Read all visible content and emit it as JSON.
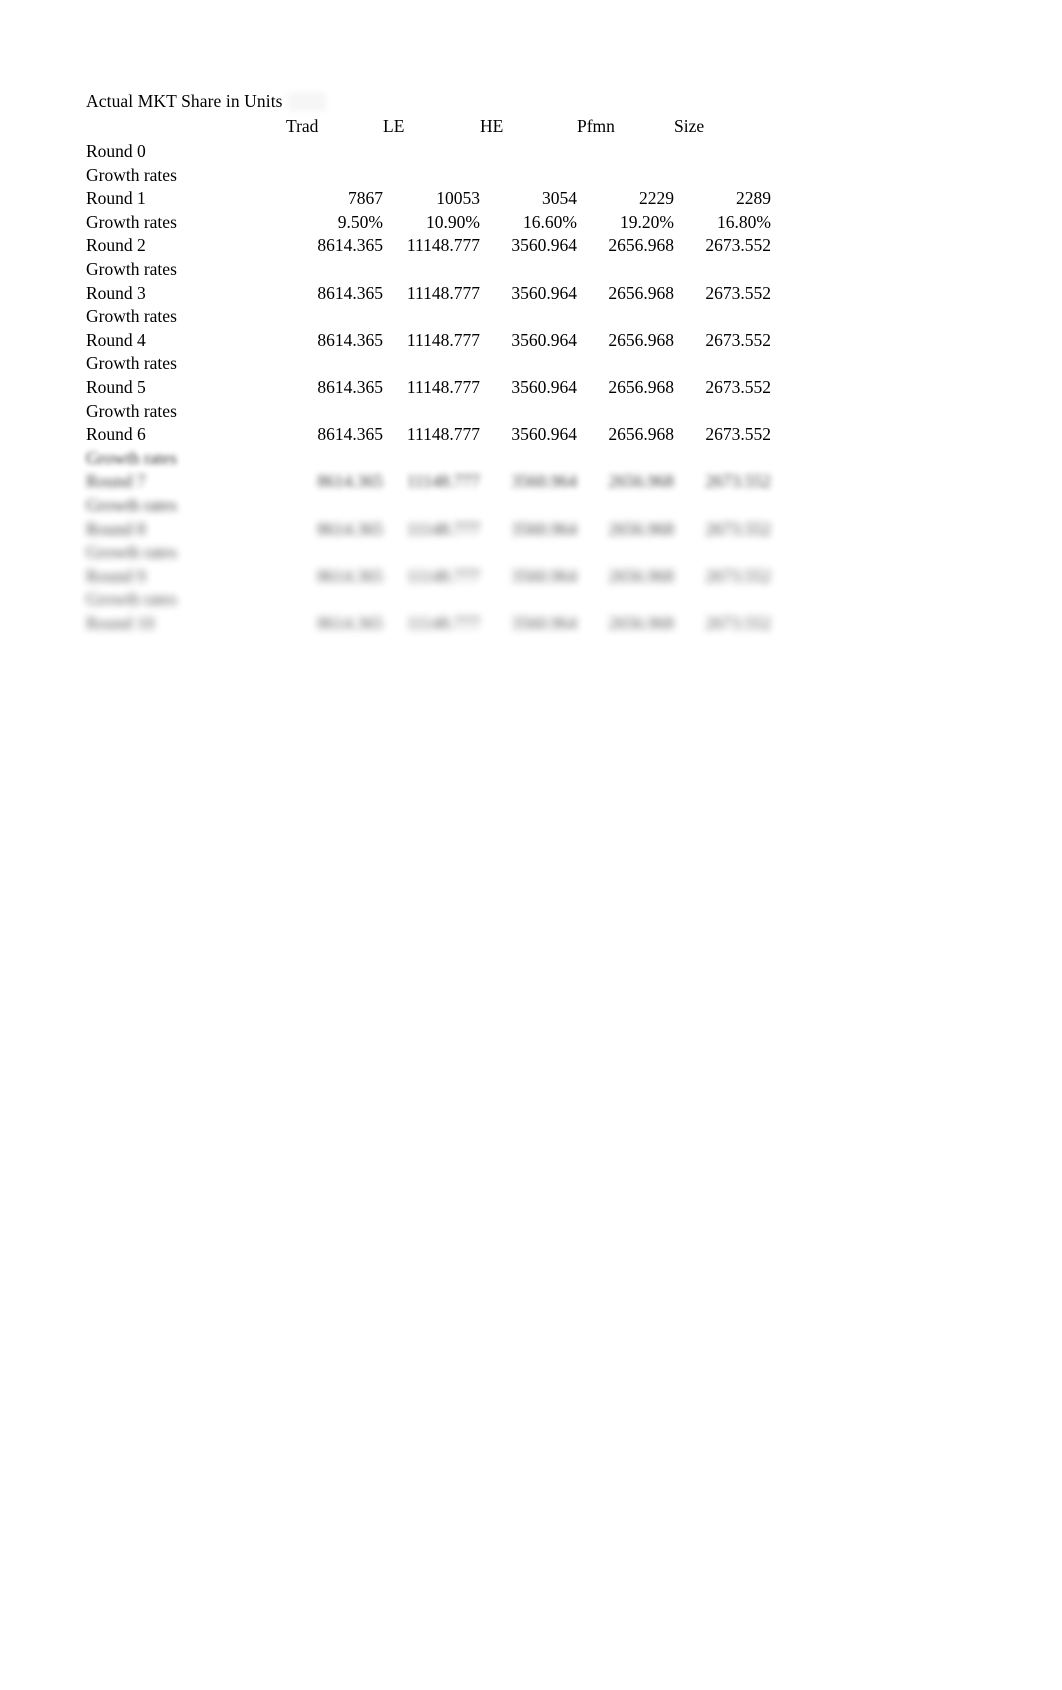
{
  "document": {
    "title": "Actual MKT Share in Units"
  },
  "table": {
    "row_header_label": "",
    "columns": [
      "Trad",
      "LE",
      "HE",
      "Pfmn",
      "Size"
    ],
    "rows": [
      {
        "label": "Round 0",
        "kind": "round",
        "values": [
          "",
          "",
          "",
          "",
          ""
        ]
      },
      {
        "label": "Growth rates",
        "kind": "growth",
        "values": [
          "",
          "",
          "",
          "",
          ""
        ]
      },
      {
        "label": "Round 1",
        "kind": "round",
        "values": [
          "7867",
          "10053",
          "3054",
          "2229",
          "2289"
        ]
      },
      {
        "label": "Growth rates",
        "kind": "growth",
        "values": [
          "9.50%",
          "10.90%",
          "16.60%",
          "19.20%",
          "16.80%"
        ]
      },
      {
        "label": "Round 2",
        "kind": "round",
        "values": [
          "8614.365",
          "11148.777",
          "3560.964",
          "2656.968",
          "2673.552"
        ]
      },
      {
        "label": "Growth rates",
        "kind": "growth",
        "values": [
          "",
          "",
          "",
          "",
          ""
        ]
      },
      {
        "label": "Round 3",
        "kind": "round",
        "values": [
          "8614.365",
          "11148.777",
          "3560.964",
          "2656.968",
          "2673.552"
        ]
      },
      {
        "label": "Growth rates",
        "kind": "growth",
        "values": [
          "",
          "",
          "",
          "",
          ""
        ]
      },
      {
        "label": "Round 4",
        "kind": "round",
        "values": [
          "8614.365",
          "11148.777",
          "3560.964",
          "2656.968",
          "2673.552"
        ]
      },
      {
        "label": "Growth rates",
        "kind": "growth",
        "values": [
          "",
          "",
          "",
          "",
          ""
        ]
      },
      {
        "label": "Round 5",
        "kind": "round",
        "values": [
          "8614.365",
          "11148.777",
          "3560.964",
          "2656.968",
          "2673.552"
        ]
      },
      {
        "label": "Growth rates",
        "kind": "growth",
        "values": [
          "",
          "",
          "",
          "",
          ""
        ]
      },
      {
        "label": "Round 6",
        "kind": "round",
        "values": [
          "8614.365",
          "11148.777",
          "3560.964",
          "2656.968",
          "2673.552"
        ]
      },
      {
        "label": "Growth rates",
        "kind": "growth",
        "values": [
          "",
          "",
          "",
          "",
          ""
        ]
      },
      {
        "label": "Round 7",
        "kind": "round",
        "values": [
          "8614.365",
          "11148.777",
          "3560.964",
          "2656.968",
          "2673.552"
        ]
      },
      {
        "label": "Growth rates",
        "kind": "growth",
        "values": [
          "",
          "",
          "",
          "",
          ""
        ]
      },
      {
        "label": "Round 8",
        "kind": "round",
        "values": [
          "8614.365",
          "11148.777",
          "3560.964",
          "2656.968",
          "2673.552"
        ]
      },
      {
        "label": "Growth rates",
        "kind": "growth",
        "values": [
          "",
          "",
          "",
          "",
          ""
        ]
      },
      {
        "label": "Round 9",
        "kind": "round",
        "values": [
          "8614.365",
          "11148.777",
          "3560.964",
          "2656.968",
          "2673.552"
        ]
      },
      {
        "label": "Growth rates",
        "kind": "growth",
        "values": [
          "",
          "",
          "",
          "",
          ""
        ]
      },
      {
        "label": "Round 10",
        "kind": "round",
        "values": [
          "8614.365",
          "11148.777",
          "3560.964",
          "2656.968",
          "2673.552"
        ]
      }
    ]
  },
  "style": {
    "text_color": "#000000",
    "background": "#ffffff"
  },
  "blur": {
    "first_blurred_row_index": 13,
    "note": "Rows from index 13 downward are progressively blurred in the source image."
  }
}
